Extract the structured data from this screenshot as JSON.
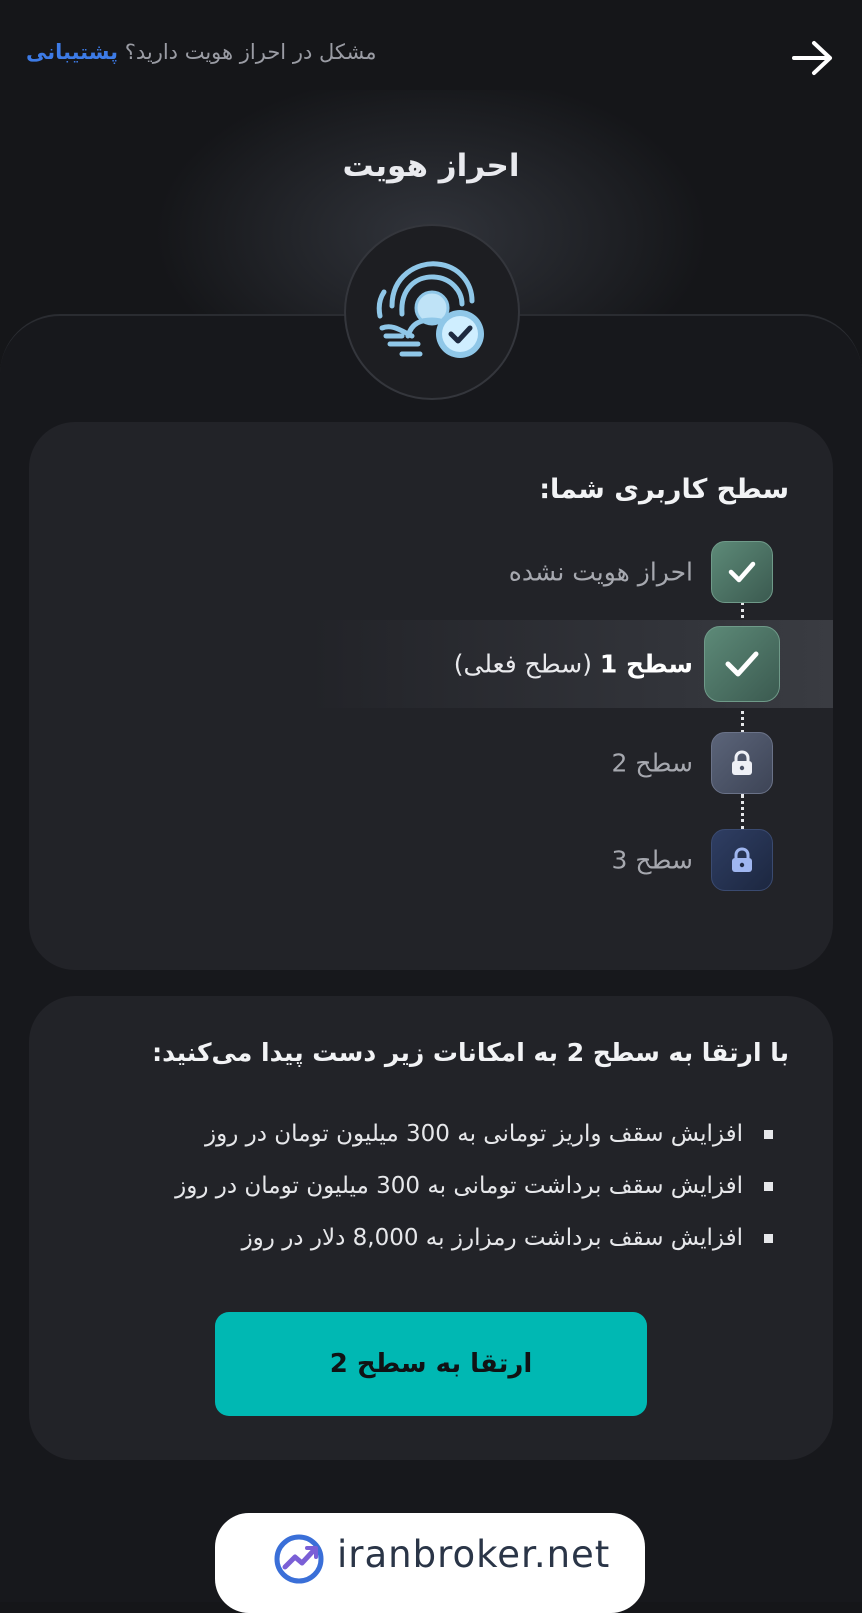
{
  "header": {
    "help_text": "مشکل در احراز هویت دارید؟",
    "support_link": "پشتیبانی",
    "back_icon": "arrow-right-icon"
  },
  "page": {
    "title": "احراز هویت",
    "badge_icon": "fingerprint-verified-icon"
  },
  "user_level": {
    "title": "سطح کاربری شما:",
    "levels": [
      {
        "label": "احراز هویت نشده",
        "status": "completed",
        "icon": "check-icon"
      },
      {
        "label": "سطح 1",
        "note": "(سطح فعلی)",
        "status": "current",
        "icon": "check-icon"
      },
      {
        "label": "سطح 2",
        "status": "locked",
        "icon": "lock-icon"
      },
      {
        "label": "سطح 3",
        "status": "locked",
        "icon": "lock-icon"
      }
    ]
  },
  "upgrade": {
    "title": "با ارتقا به سطح 2 به امکانات زیر دست پیدا می‌کنید:",
    "features": [
      "افزایش سقف واریز تومانی به 300 میلیون تومان در روز",
      "افزایش سقف برداشت تومانی به 300 میلیون تومان در روز",
      "افزایش سقف برداشت رمزارز به 8,000 دلار در روز"
    ],
    "button_label": "ارتقا به سطح 2"
  },
  "watermark": {
    "text": "iranbroker.net"
  },
  "colors": {
    "background": "#151619",
    "card": "#222328",
    "accent": "#00b8b3",
    "link": "#3d7be6"
  }
}
